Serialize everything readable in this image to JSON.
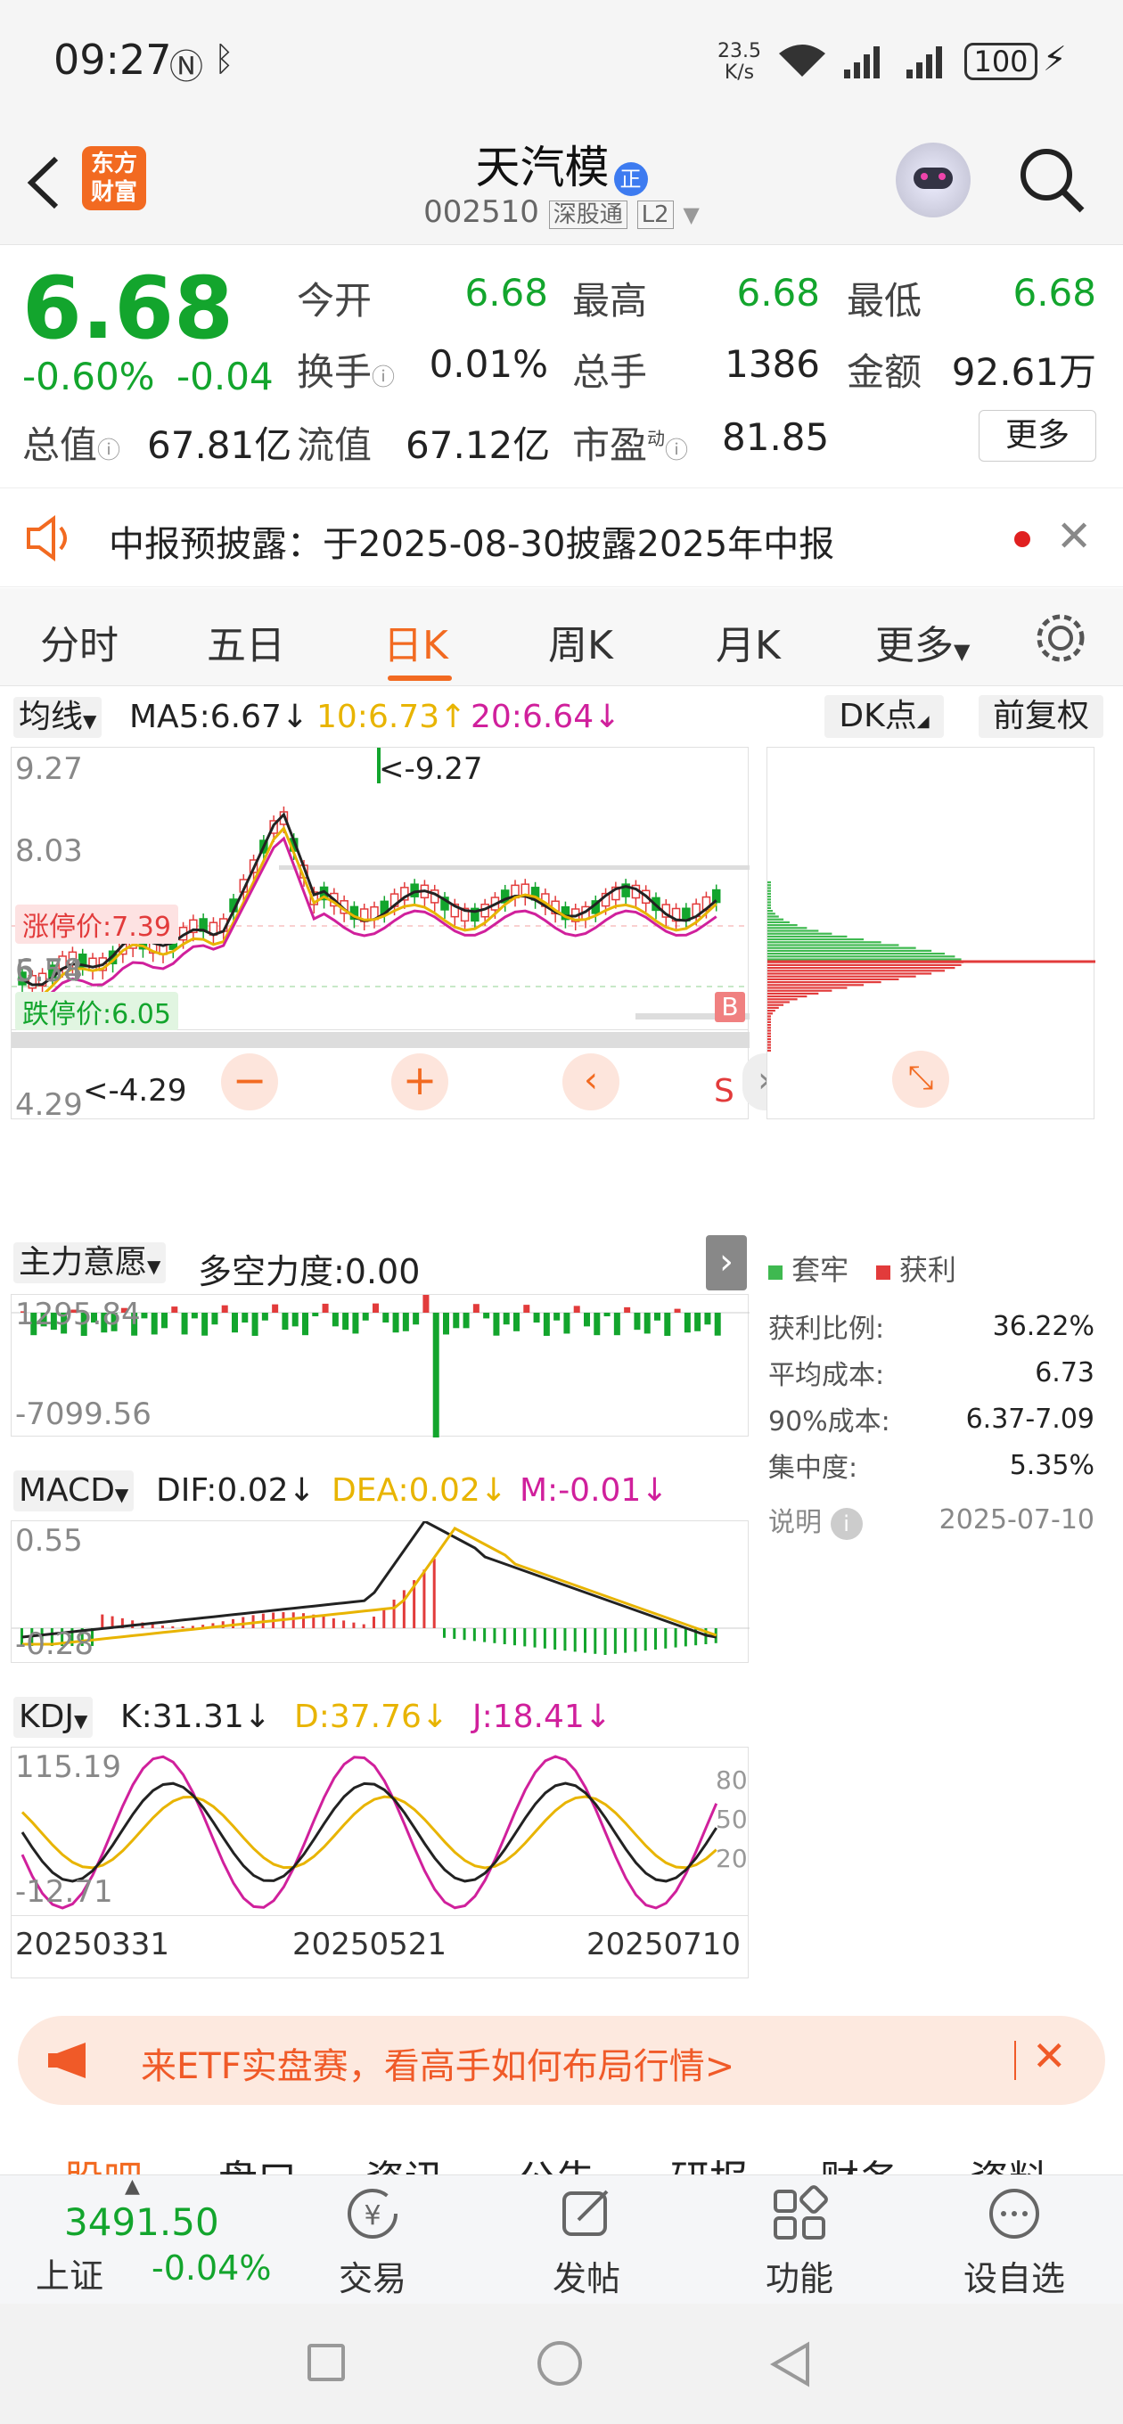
{
  "status_bar": {
    "time": "09:27",
    "net_speed": "23.5",
    "net_unit": "K/s",
    "battery": "100"
  },
  "header": {
    "back_icon": "back-arrow-icon",
    "logo_line1": "东方",
    "logo_line2": "财富",
    "stock_name": "天汽模",
    "badge": "正",
    "stock_code": "002510",
    "exchange_tag": "深股通",
    "level_tag": "L2"
  },
  "quote": {
    "price": "6.68",
    "change_pct": "-0.60%",
    "change_amt": "-0.04",
    "open_label": "今开",
    "open": "6.68",
    "high_label": "最高",
    "high": "6.68",
    "low_label": "最低",
    "low": "6.68",
    "turnover_label": "换手",
    "turnover": "0.01%",
    "volume_label": "总手",
    "volume": "1386",
    "amount_label": "金额",
    "amount": "92.61万",
    "mktcap_label": "总值",
    "mktcap": "67.81亿",
    "float_label": "流值",
    "float_cap": "67.12亿",
    "pe_label": "市盈",
    "pe_sup": "动",
    "pe": "81.85",
    "more_button": "更多"
  },
  "notice": {
    "text": "中报预披露：于2025-08-30披露2025年中报"
  },
  "tabs": [
    "分时",
    "五日",
    "日K",
    "周K",
    "月K",
    "更多"
  ],
  "active_tab": "日K",
  "kline": {
    "ma_selector": "均线",
    "ma5": "MA5:6.67",
    "ma10": "10:6.73",
    "ma20": "20:6.64",
    "dk_button": "DK点",
    "adj_button": "前复权",
    "y_labels": [
      "9.27",
      "8.03",
      "6.78",
      "5.54",
      "4.29"
    ],
    "max_note": "<-9.27",
    "min_note": "<-4.29",
    "limit_up": "涨停价:7.39",
    "limit_down": "跌停价:6.05",
    "buy_marker": "B",
    "sell_marker": "S"
  },
  "chip": {
    "legend_locked": "套牢",
    "legend_profit": "获利",
    "rows": [
      {
        "label": "获利比例:",
        "value": "36.22%"
      },
      {
        "label": "平均成本:",
        "value": "6.73"
      },
      {
        "label": "90%成本:",
        "value": "6.37-7.09"
      },
      {
        "label": "集中度:",
        "value": "5.35%"
      }
    ],
    "note_label": "说明",
    "date": "2025-07-10"
  },
  "force": {
    "selector": "主力意愿",
    "value_text": "多空力度:0.00",
    "top": "1295.84",
    "bottom": "-7099.56"
  },
  "macd": {
    "selector": "MACD",
    "dif": "DIF:0.02",
    "dea": "DEA:0.02",
    "m": "M:-0.01",
    "top": "0.55",
    "bottom": "-0.28"
  },
  "kdj": {
    "selector": "KDJ",
    "k": "K:31.31",
    "d": "D:37.76",
    "j": "J:18.41",
    "top": "115.19",
    "bottom": "-12.71",
    "r80": "80",
    "r50": "50",
    "r20": "20",
    "dates": [
      "20250331",
      "20250521",
      "20250710"
    ]
  },
  "promo": {
    "text": "来ETF实盘赛，看高手如何布局行情>"
  },
  "sub_tabs": [
    "股吧",
    "盘口",
    "资讯",
    "公告",
    "研报",
    "财务",
    "资料"
  ],
  "bottom": {
    "index_value": "3491.50",
    "index_name": "上证",
    "index_change": "-0.04%",
    "items": [
      {
        "label": "交易",
        "icon": "trade-icon"
      },
      {
        "label": "发帖",
        "icon": "post-icon"
      },
      {
        "label": "功能",
        "icon": "function-grid-icon"
      },
      {
        "label": "设自选",
        "icon": "add-watchlist-icon"
      }
    ]
  },
  "colors": {
    "up": "#e23b3b",
    "down": "#13a52d",
    "accent": "#f26a21",
    "ma10": "#e8b400",
    "ma20": "#d0209c"
  }
}
